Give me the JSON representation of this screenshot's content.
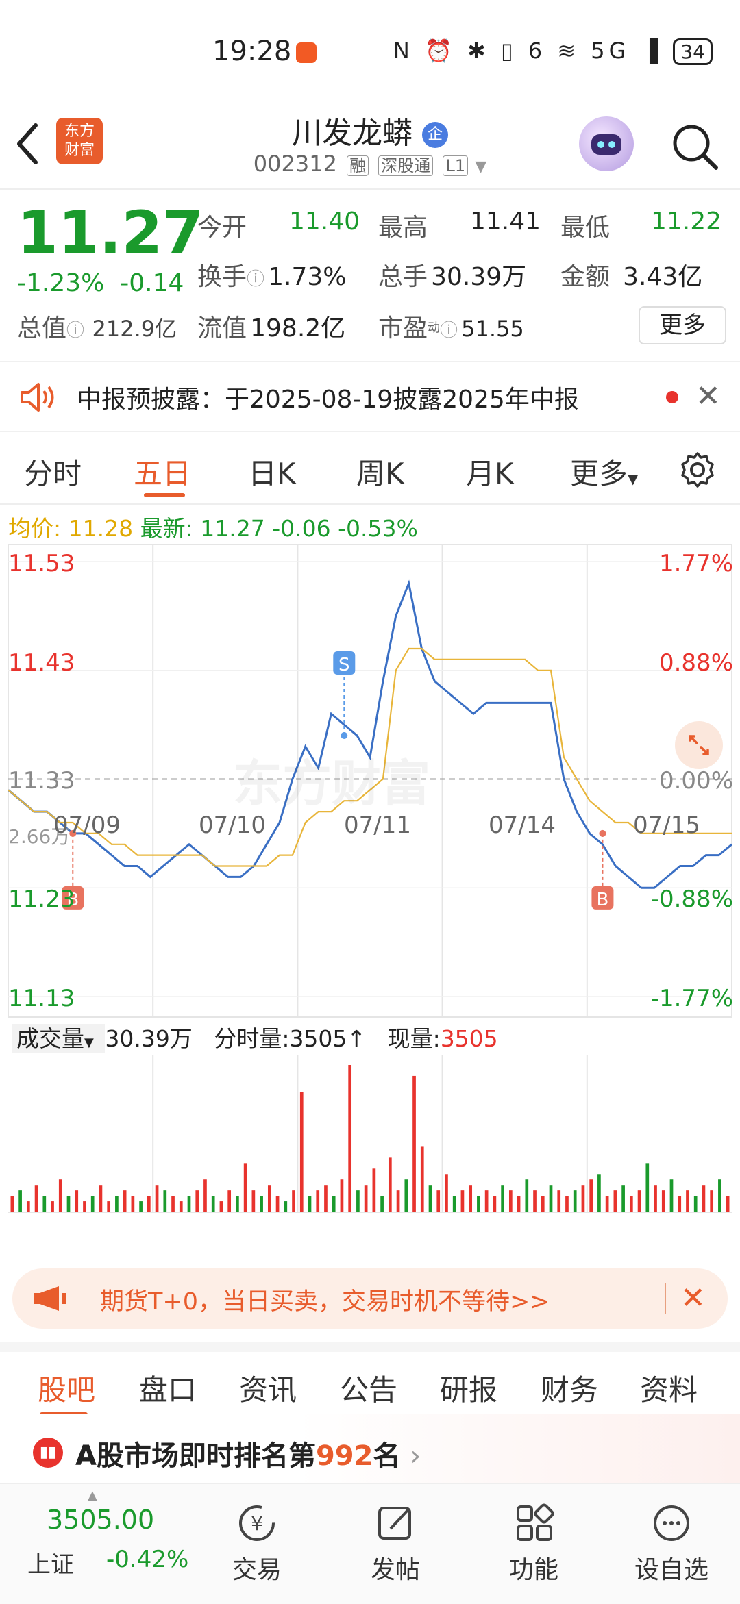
{
  "status_bar": {
    "time": "19:28",
    "icons": "N ⏰ ✱ ▯ 6 ≋ 5G ▐",
    "battery": "34"
  },
  "header": {
    "logo_line1": "东方",
    "logo_line2": "财富",
    "stock_name": "川发龙蟒",
    "qi_badge": "企",
    "stock_code": "002312",
    "tags": [
      "融",
      "深股通",
      "L1"
    ]
  },
  "quote": {
    "price": "11.27",
    "change_pct": "-1.23%",
    "change": "-0.14",
    "open_label": "今开",
    "open": "11.40",
    "high_label": "最高",
    "high": "11.41",
    "low_label": "最低",
    "low": "11.22",
    "turnover_label": "换手",
    "turnover": "1.73%",
    "volume_label": "总手",
    "volume": "30.39万",
    "amount_label": "金额",
    "amount": "3.43亿",
    "total_value_label": "总值",
    "total_value": "212.9亿",
    "float_value_label": "流值",
    "float_value": "198.2亿",
    "pe_label": "市盈",
    "pe_sup": "动",
    "pe": "51.55",
    "more": "更多"
  },
  "notice": {
    "text": "中报预披露：于2025-08-19披露2025年中报"
  },
  "kline_tabs": [
    "分时",
    "五日",
    "日K",
    "周K",
    "月K",
    "更多"
  ],
  "avg_bar": {
    "avg_label": "均价:",
    "avg": "11.28",
    "latest_label": "最新:",
    "latest": "11.27",
    "chg": "-0.06",
    "pct": "-0.53%"
  },
  "chart_data": {
    "type": "line",
    "x": [
      "07/09",
      "07/10",
      "07/11",
      "07/14",
      "07/15"
    ],
    "y_left_ticks": [
      "11.53",
      "11.43",
      "11.33",
      "11.23",
      "11.13"
    ],
    "y_right_ticks": [
      "1.77%",
      "0.88%",
      "0.00%",
      "-0.88%",
      "-1.77%"
    ],
    "ylim": [
      11.13,
      11.53
    ],
    "prev_close": 11.33,
    "series": [
      {
        "values": [
          11.32,
          11.31,
          11.3,
          11.3,
          11.29,
          11.28,
          11.28,
          11.27,
          11.26,
          11.25,
          11.25,
          11.24,
          11.25,
          11.26,
          11.27,
          11.26,
          11.25,
          11.24,
          11.24,
          11.25,
          11.27,
          11.29,
          11.33,
          11.36,
          11.34,
          11.39,
          11.38,
          11.37,
          11.35,
          11.42,
          11.48,
          11.51,
          11.45,
          11.42,
          11.41,
          11.4,
          11.39,
          11.4,
          11.4,
          11.4,
          11.4,
          11.4,
          11.4,
          11.33,
          11.3,
          11.28,
          11.27,
          11.25,
          11.24,
          11.23,
          11.23,
          11.24,
          11.25,
          11.25,
          11.26,
          11.26,
          11.27
        ]
      },
      {
        "values": [
          11.32,
          11.31,
          11.3,
          11.3,
          11.29,
          11.29,
          11.28,
          11.28,
          11.27,
          11.27,
          11.26,
          11.26,
          11.26,
          11.26,
          11.26,
          11.26,
          11.25,
          11.25,
          11.25,
          11.25,
          11.25,
          11.26,
          11.26,
          11.29,
          11.3,
          11.3,
          11.31,
          11.31,
          11.32,
          11.33,
          11.43,
          11.45,
          11.45,
          11.44,
          11.44,
          11.44,
          11.44,
          11.44,
          11.44,
          11.44,
          11.44,
          11.43,
          11.43,
          11.35,
          11.33,
          11.31,
          11.3,
          11.29,
          11.29,
          11.28,
          11.28,
          11.28,
          11.28,
          11.28,
          11.28,
          11.28,
          11.28
        ]
      }
    ],
    "markers": [
      {
        "label": "B",
        "x_index": 5,
        "value": 11.28
      },
      {
        "label": "S",
        "x_index": 26,
        "value": 11.37
      },
      {
        "label": "B",
        "x_index": 46,
        "value": 11.28
      }
    ],
    "watermark": "东方财富",
    "volume": {
      "label": "成交量",
      "total": "30.39万",
      "minute_label": "分时量:",
      "minute": "3505↑",
      "now_label": "现量:",
      "now": "3505",
      "max_tick": "2.66万",
      "values": [
        3,
        4,
        2,
        5,
        3,
        2,
        6,
        3,
        4,
        2,
        3,
        5,
        2,
        3,
        4,
        3,
        2,
        3,
        5,
        4,
        3,
        2,
        3,
        4,
        6,
        3,
        2,
        4,
        3,
        9,
        4,
        3,
        5,
        3,
        2,
        4,
        22,
        3,
        4,
        5,
        3,
        6,
        27,
        4,
        5,
        8,
        3,
        10,
        4,
        6,
        25,
        12,
        5,
        4,
        7,
        3,
        4,
        5,
        3,
        4,
        3,
        5,
        4,
        3,
        6,
        4,
        3,
        5,
        4,
        3,
        4,
        5,
        6,
        7,
        3,
        4,
        5,
        3,
        4,
        9,
        5,
        4,
        6,
        3,
        4,
        3,
        5,
        4,
        6,
        3
      ]
    }
  },
  "ad": {
    "text": "期货T+0，当日买卖，交易时机不等待>>"
  },
  "bottom_tabs": [
    "股吧",
    "盘口",
    "资讯",
    "公告",
    "研报",
    "财务",
    "资料"
  ],
  "rank": {
    "prefix": "A股市场即时排名第",
    "num": "992",
    "suffix": "名",
    "arrow": "›"
  },
  "bottom_nav": {
    "index_value": "3505.00",
    "index_name": "上证",
    "index_chg": "-0.42%",
    "items": [
      "交易",
      "发帖",
      "功能",
      "设自选"
    ]
  }
}
